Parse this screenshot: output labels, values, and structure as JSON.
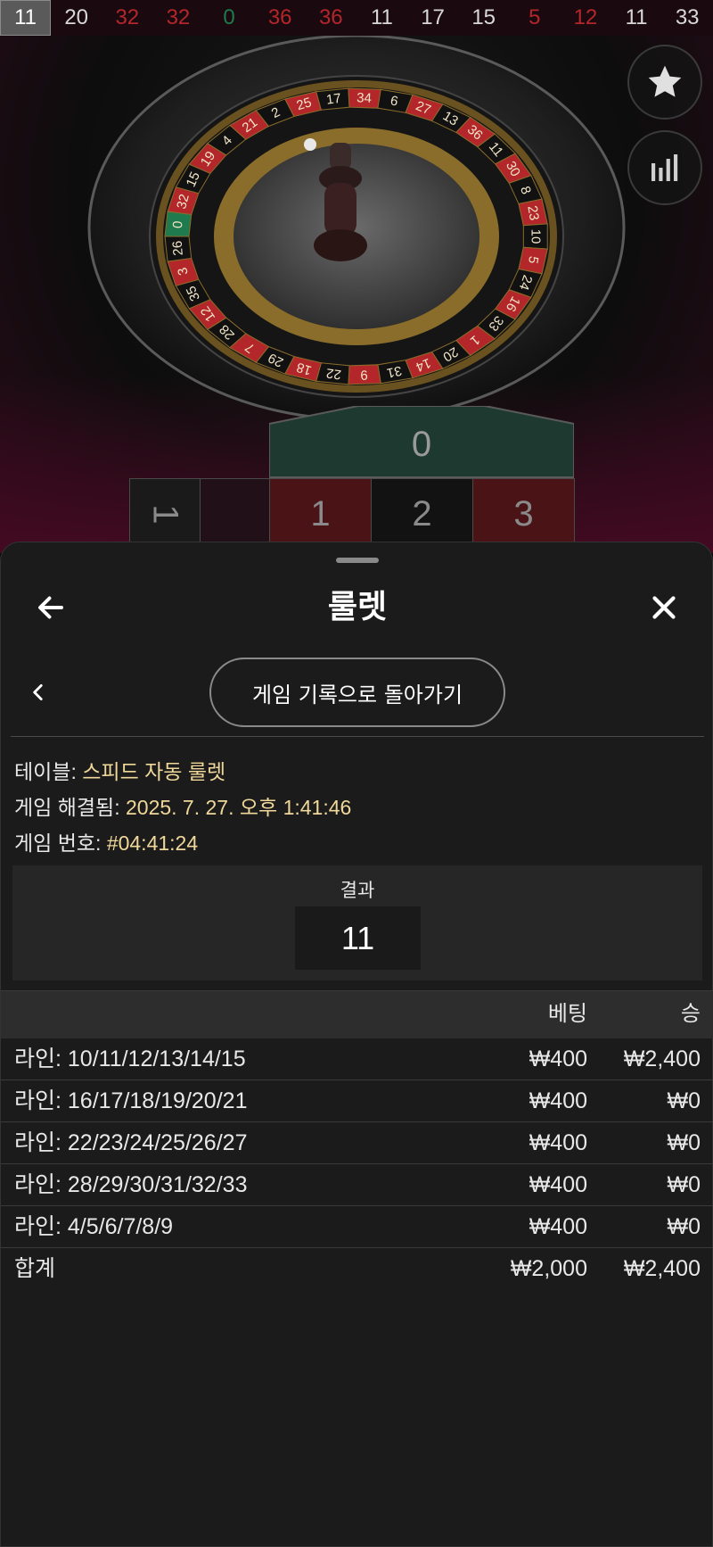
{
  "history": [
    {
      "value": "11",
      "color": "black"
    },
    {
      "value": "20",
      "color": "black"
    },
    {
      "value": "32",
      "color": "red"
    },
    {
      "value": "32",
      "color": "red"
    },
    {
      "value": "0",
      "color": "green"
    },
    {
      "value": "36",
      "color": "red"
    },
    {
      "value": "36",
      "color": "red"
    },
    {
      "value": "11",
      "color": "black"
    },
    {
      "value": "17",
      "color": "black"
    },
    {
      "value": "15",
      "color": "black"
    },
    {
      "value": "5",
      "color": "red"
    },
    {
      "value": "12",
      "color": "red"
    },
    {
      "value": "11",
      "color": "black"
    },
    {
      "value": "33",
      "color": "black"
    }
  ],
  "scene": {
    "wheel_numbers": [
      "0",
      "32",
      "15",
      "19",
      "4",
      "21",
      "2",
      "25",
      "17",
      "34",
      "6",
      "27",
      "13",
      "36",
      "11",
      "30",
      "8",
      "23",
      "10",
      "5",
      "24",
      "16",
      "33",
      "1",
      "20",
      "14",
      "31",
      "9",
      "22",
      "18",
      "29",
      "7",
      "28",
      "12",
      "35",
      "3",
      "26"
    ],
    "favorites_icon": "star-icon",
    "stats_icon": "bar-chart-icon",
    "table": {
      "zero": "0",
      "numbers": [
        "1",
        "2",
        "3"
      ],
      "side_label": "1"
    }
  },
  "sheet": {
    "title": "룰렛",
    "back_icon": "arrow-left-icon",
    "close_icon": "close-icon",
    "prev_icon": "chevron-left-icon",
    "back_to_history": "게임 기록으로 돌아가기",
    "info": {
      "table_label": "테이블:",
      "table_value": "스피드 자동 룰렛",
      "resolved_label": "게임 해결됨:",
      "resolved_value": "2025. 7. 27. 오후 1:41:46",
      "number_label": "게임 번호:",
      "number_value": "#04:41:24"
    },
    "result": {
      "label": "결과",
      "value": "11"
    },
    "bets": {
      "headers": {
        "bet": "베팅",
        "win": "승"
      },
      "rows": [
        {
          "name": "라인: 10/11/12/13/14/15",
          "bet": "₩400",
          "win": "₩2,400"
        },
        {
          "name": "라인: 16/17/18/19/20/21",
          "bet": "₩400",
          "win": "₩0"
        },
        {
          "name": "라인: 22/23/24/25/26/27",
          "bet": "₩400",
          "win": "₩0"
        },
        {
          "name": "라인: 28/29/30/31/32/33",
          "bet": "₩400",
          "win": "₩0"
        },
        {
          "name": "라인: 4/5/6/7/8/9",
          "bet": "₩400",
          "win": "₩0"
        }
      ],
      "total": {
        "name": "합계",
        "bet": "₩2,000",
        "win": "₩2,400"
      }
    }
  },
  "colors": {
    "red": "#b3262a",
    "green": "#1f7a4d",
    "accent_text": "#f0d89a",
    "sheet_bg": "#1b1b1b"
  }
}
